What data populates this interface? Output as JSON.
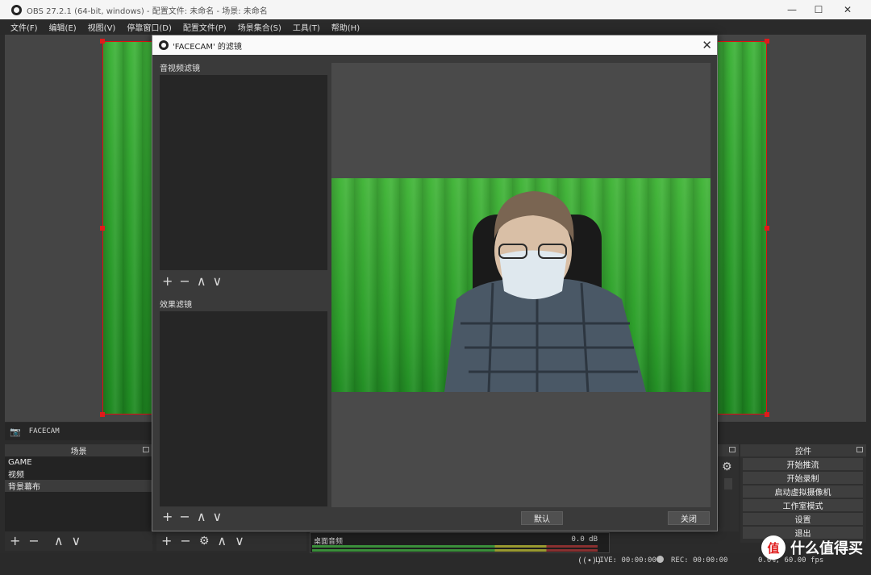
{
  "window": {
    "title": "OBS 27.2.1 (64-bit, windows) - 配置文件: 未命名 - 场景: 未命名",
    "minimize": "—",
    "maximize": "☐",
    "close": "✕"
  },
  "menu": [
    "文件(F)",
    "编辑(E)",
    "视图(V)",
    "停靠窗口(D)",
    "配置文件(P)",
    "场景集合(S)",
    "工具(T)",
    "帮助(H)"
  ],
  "source_strip": {
    "name": "FACECAM"
  },
  "scenes": {
    "header": "场景",
    "items": [
      "GAME",
      "视频",
      "背景幕布"
    ],
    "selected_index": 2
  },
  "controls": {
    "header": "控件",
    "buttons": [
      "开始推流",
      "开始录制",
      "启动虚拟摄像机",
      "工作室模式",
      "设置",
      "退出"
    ]
  },
  "mixer": {
    "track_name": "桌面音频",
    "level": "0.0 dB"
  },
  "status": {
    "live": "LIVE: 00:00:00",
    "rec": "REC: 00:00:00",
    "cpu": "0.0%, 60.00 fps"
  },
  "dialog": {
    "title": "'FACECAM' 的滤镜",
    "close": "✕",
    "audio_video_filters_label": "音视频滤镜",
    "effect_filters_label": "效果滤镜",
    "default_button": "默认",
    "close_button": "关闭"
  },
  "watermark": {
    "badge": "值",
    "text": "什么值得买"
  },
  "icons": {
    "add": "+",
    "remove": "−",
    "up": "∧",
    "down": "∨",
    "gear": "⚙",
    "camera": "📷"
  },
  "colors": {
    "selection_border": "#d11111",
    "chroma_green": "#2ea02c"
  }
}
